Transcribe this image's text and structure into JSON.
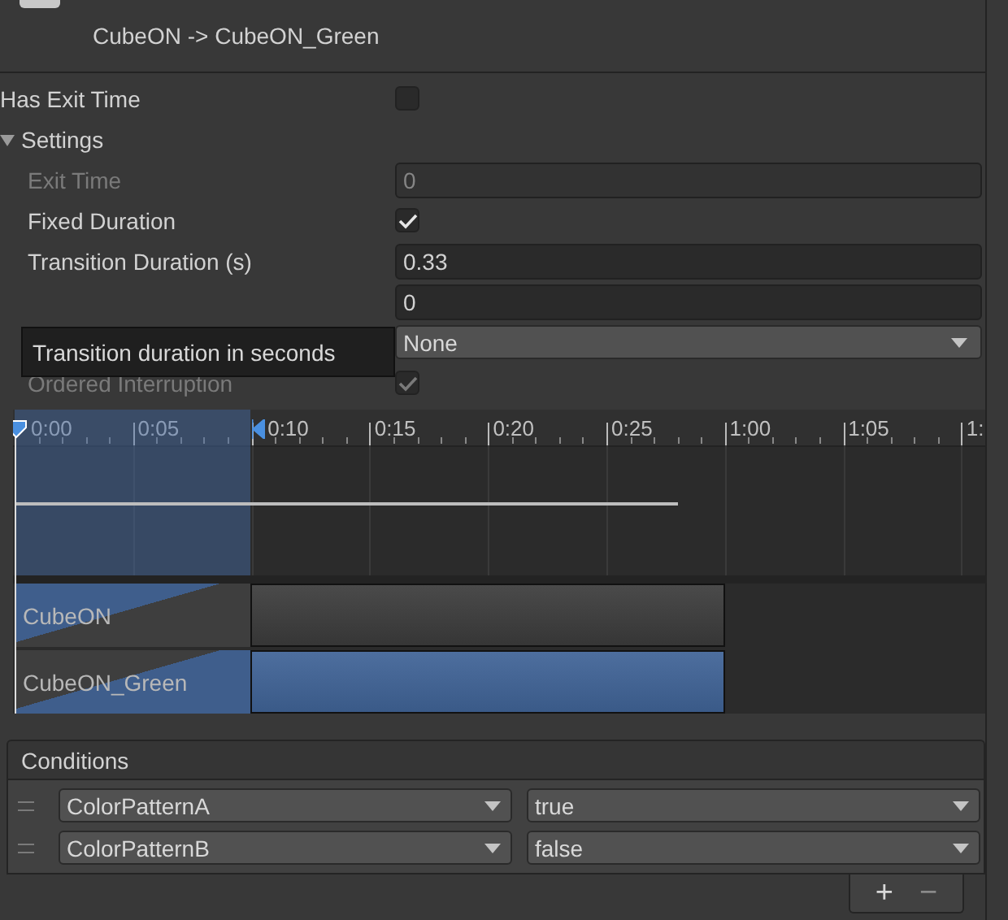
{
  "header": {
    "title": "CubeON -> CubeON_Green"
  },
  "has_exit_time": {
    "label": "Has Exit Time",
    "checked": false
  },
  "settings": {
    "label": "Settings",
    "expanded": true,
    "rows": [
      {
        "kind": "number",
        "label": "Exit Time",
        "value": "0",
        "disabled": true
      },
      {
        "kind": "checkbox",
        "label": "Fixed Duration",
        "checked": true,
        "disabled": false
      },
      {
        "kind": "number",
        "label": "Transition Duration (s)",
        "value": "0.33",
        "disabled": false
      },
      {
        "kind": "number",
        "value": "0",
        "disabled": false
      },
      {
        "kind": "dropdown",
        "value": "None",
        "disabled": false
      },
      {
        "kind": "checkbox",
        "label": "Ordered Interruption",
        "checked": true,
        "disabled": true
      }
    ]
  },
  "tooltip": {
    "text": "Transition duration in seconds"
  },
  "timeline": {
    "ticks": [
      "0:00",
      "0:05",
      "0:10",
      "0:15",
      "0:20",
      "0:25",
      "1:00",
      "1:05",
      "1:"
    ],
    "clips": [
      {
        "kind": "source",
        "label": "CubeON"
      },
      {
        "kind": "destination",
        "label": "CubeON_Green"
      }
    ]
  },
  "conditions": {
    "title": "Conditions",
    "rows": [
      {
        "parameter": "ColorPatternA",
        "value": "true"
      },
      {
        "parameter": "ColorPatternB",
        "value": "false"
      }
    ],
    "buttons": [
      "+",
      "−"
    ]
  }
}
